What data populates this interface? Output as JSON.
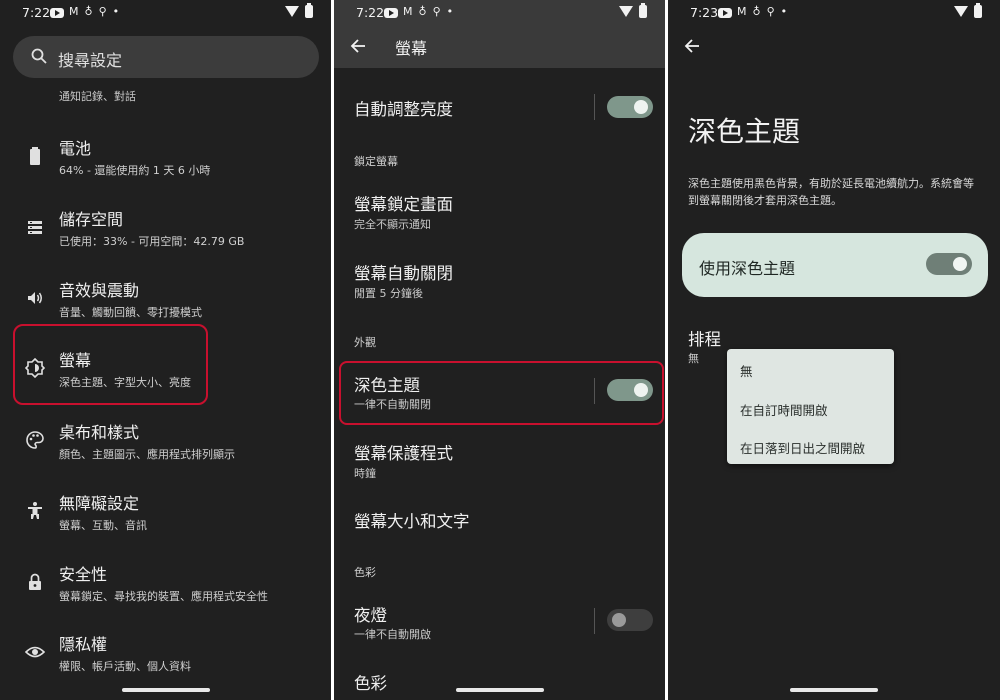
{
  "colors": {
    "screen_bg": "#202020",
    "appbar_bg": "#3a3a3a",
    "accent_toggle_on": "#7f978b",
    "highlight_box": "#c8102e",
    "card_bg": "#d6e6de",
    "menu_bg": "#dfe6e2"
  },
  "screen1": {
    "status_time": "7:22",
    "search_placeholder": "搜尋設定",
    "partial_subtitle": "通知記錄、對話",
    "items": [
      {
        "icon": "battery-icon",
        "title": "電池",
        "subtitle": "64% - 還能使用約 1 天 6 小時"
      },
      {
        "icon": "storage-icon",
        "title": "儲存空間",
        "subtitle": "已使用：33% - 可用空間：42.79 GB"
      },
      {
        "icon": "volume-icon",
        "title": "音效與震動",
        "subtitle": "音量、觸動回饋、零打擾模式"
      },
      {
        "icon": "brightness-icon",
        "title": "螢幕",
        "subtitle": "深色主題、字型大小、亮度"
      },
      {
        "icon": "palette-icon",
        "title": "桌布和樣式",
        "subtitle": "顏色、主題圖示、應用程式排列顯示"
      },
      {
        "icon": "accessibility-icon",
        "title": "無障礙設定",
        "subtitle": "螢幕、互動、音訊"
      },
      {
        "icon": "lock-icon",
        "title": "安全性",
        "subtitle": "螢幕鎖定、尋找我的裝置、應用程式安全性"
      },
      {
        "icon": "privacy-eye-icon",
        "title": "隱私權",
        "subtitle": "權限、帳戶活動、個人資料"
      }
    ]
  },
  "screen2": {
    "status_time": "7:22",
    "title": "螢幕",
    "auto_brightness": {
      "title": "自動調整亮度",
      "on": true
    },
    "section_lock": "鎖定螢幕",
    "lock_screen": {
      "title": "螢幕鎖定畫面",
      "subtitle": "完全不顯示通知"
    },
    "screen_timeout": {
      "title": "螢幕自動關閉",
      "subtitle": "閒置 5 分鐘後"
    },
    "section_appearance": "外觀",
    "dark_theme": {
      "title": "深色主題",
      "subtitle": "一律不自動關閉",
      "on": true
    },
    "screensaver": {
      "title": "螢幕保護程式",
      "subtitle": "時鐘"
    },
    "display_size": {
      "title": "螢幕大小和文字"
    },
    "section_color": "色彩",
    "night_light": {
      "title": "夜燈",
      "subtitle": "一律不自動開啟",
      "on": false
    },
    "colors_item": {
      "title": "色彩"
    }
  },
  "screen3": {
    "status_time": "7:23",
    "title": "深色主題",
    "description": "深色主題使用黑色背景，有助於延長電池續航力。系統會等到螢幕關閉後才套用深色主題。",
    "use_dark_label": "使用深色主題",
    "use_dark_on": true,
    "schedule_title": "排程",
    "schedule_value": "無",
    "menu_options": [
      "無",
      "在自訂時間開啟",
      "在日落到日出之間開啟"
    ]
  }
}
